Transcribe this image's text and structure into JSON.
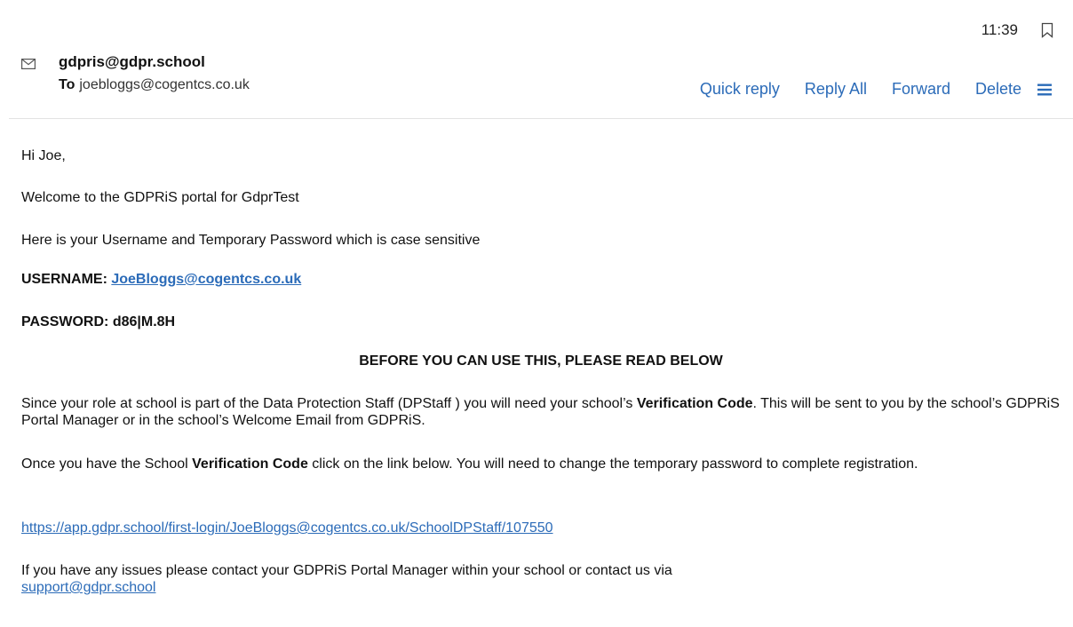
{
  "header": {
    "time": "11:39",
    "sender": "gdpris@gdpr.school",
    "to_label": "To",
    "to_address": "joebloggs@cogentcs.co.uk",
    "actions": [
      "Quick reply",
      "Reply All",
      "Forward",
      "Delete"
    ],
    "icons": {
      "mail": "mail-icon",
      "bookmark": "bookmark-icon",
      "menu": "hamburger-menu-icon"
    },
    "link_color": "#2b6bb8"
  },
  "message": {
    "greeting": "Hi Joe,",
    "welcome": "Welcome to the GDPRiS portal for GdprTest",
    "creds_intro": "Here is your Username and Temporary Password which is case sensitive",
    "username_label": "USERNAME:",
    "username_value": "JoeBloggs@cogentcs.co.uk",
    "password_label": "PASSWORD:",
    "password_value": "d86|M.8H",
    "heading": "BEFORE YOU CAN USE THIS, PLEASE READ BELOW",
    "role_part1": "Since your role at school is part of the Data Protection Staff (DPStaff ) you will need your school’s",
    "role_bold": "Verification Code",
    "role_part2": ". This will be sent to you by the school’s GDPRiS Portal Manager or in the school’s Welcome Email from GDPRiS.",
    "verif_part1": "Once you have the School",
    "verif_bold": "Verification Code",
    "verif_part2": "click on the link below. You will need to change the temporary password to complete registration.",
    "login_link": "https://app.gdpr.school/first-login/JoeBloggs@cogentcs.co.uk/SchoolDPStaff/107550",
    "issues_text": "If you have any issues please contact your GDPRiS Portal Manager within your school or contact us via",
    "support_email": "support@gdpr.school"
  }
}
